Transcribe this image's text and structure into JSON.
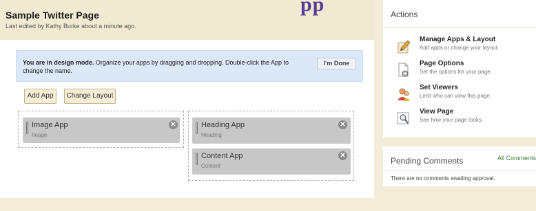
{
  "page": {
    "title": "Sample Twitter Page",
    "last_edited": "Last edited by Kathy Burke about a minute ago.",
    "brand_fragment": "pp"
  },
  "banner": {
    "bold": "You are in design mode.",
    "text": " Organize your apps by dragging and dropping. Double-click the App to change the name.",
    "done_label": "I'm Done"
  },
  "toolbar": {
    "add_app": "Add App",
    "change_layout": "Change Layout"
  },
  "columns": [
    {
      "apps": [
        {
          "title": "Image App",
          "type": "Image"
        }
      ]
    },
    {
      "apps": [
        {
          "title": "Heading App",
          "type": "Heading"
        },
        {
          "title": "Content App",
          "type": "Content"
        }
      ]
    }
  ],
  "close_glyph": "✕",
  "actions": {
    "title": "Actions",
    "items": [
      {
        "label": "Manage Apps & Layout",
        "desc": "Add apps or change your layout.",
        "icon": "pencil-paper-icon"
      },
      {
        "label": "Page Options",
        "desc": "Set the options for your page.",
        "icon": "page-settings-icon"
      },
      {
        "label": "Set Viewers",
        "desc": "Limit who can view this page.",
        "icon": "users-icon"
      },
      {
        "label": "View Page",
        "desc": "See how your page looks.",
        "icon": "magnifier-page-icon"
      }
    ]
  },
  "pending": {
    "title": "Pending Comments",
    "all_link": "All Comments",
    "empty_text": "There are no comments awaiting approval."
  },
  "colors": {
    "background": "#f3ecd9",
    "header": "#f1e9d2",
    "banner": "#dbe8f8",
    "app_box": "#c7c7c7",
    "brand": "#5a3d95"
  }
}
